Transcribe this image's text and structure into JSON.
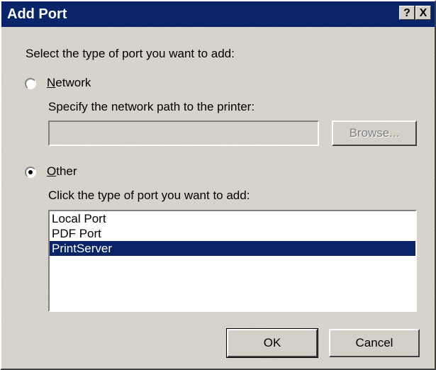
{
  "window": {
    "title": "Add Port",
    "help_button": "?",
    "close_button": "X"
  },
  "main": {
    "prompt": "Select the type of port you want to add:",
    "network": {
      "label": "Network",
      "mnemonic": "N",
      "label_rest": "etwork",
      "selected": false,
      "path_label": "Specify the network path to the printer:",
      "path_value": "",
      "browse_label": "Browse..."
    },
    "other": {
      "label": "Other",
      "mnemonic": "O",
      "label_rest": "ther",
      "selected": true,
      "list_label": "Click the type of port you want to add:",
      "port_types": [
        {
          "label": "Local Port",
          "selected": false
        },
        {
          "label": "PDF Port",
          "selected": false
        },
        {
          "label": "PrintServer",
          "selected": true
        }
      ]
    }
  },
  "footer": {
    "ok_label": "OK",
    "cancel_label": "Cancel"
  },
  "colors": {
    "titlebar": "#0a246a",
    "selection": "#0a246a",
    "face": "#d4d0c8"
  }
}
